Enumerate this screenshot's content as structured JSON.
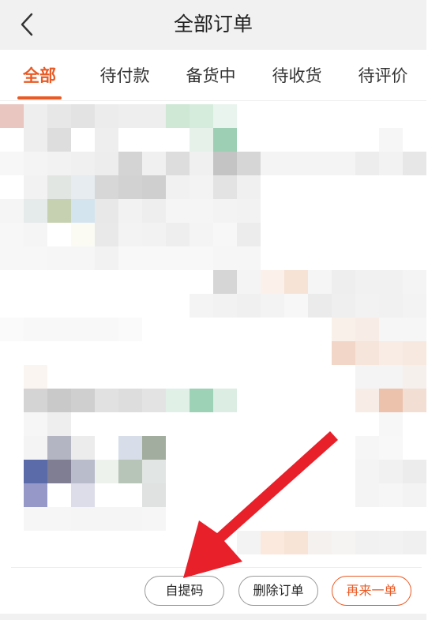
{
  "header": {
    "title": "全部订单",
    "back_icon": "chevron-left-icon"
  },
  "tabs": [
    {
      "label": "全部",
      "active": true
    },
    {
      "label": "待付款",
      "active": false
    },
    {
      "label": "备货中",
      "active": false
    },
    {
      "label": "待收货",
      "active": false
    },
    {
      "label": "待评价",
      "active": false
    }
  ],
  "actions": {
    "pickup_code": "自提码",
    "delete_order": "删除订单",
    "reorder": "再来一单"
  },
  "colors": {
    "accent": "#ea5a24",
    "arrow": "#e8202a"
  }
}
